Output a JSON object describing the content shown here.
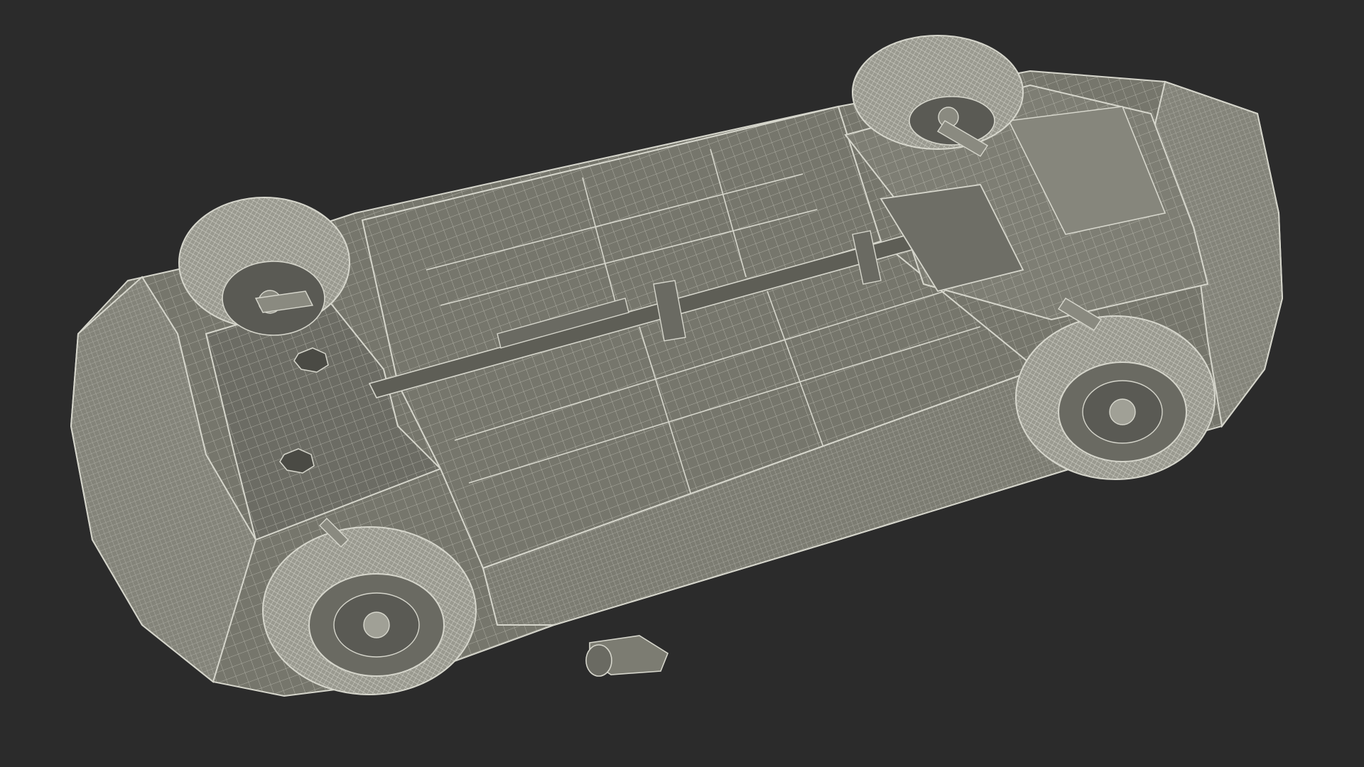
{
  "scene": {
    "subject": "car-underside-wireframe",
    "colors": {
      "background": "#2b2b2b",
      "body_fill": "#76766c",
      "body_fill_dark": "#5e5e56",
      "panel_fill": "#84847a",
      "wire": "#d6d6cc",
      "tire_fill": "#9a9a90",
      "rim_fill": "#5a5a54"
    }
  }
}
